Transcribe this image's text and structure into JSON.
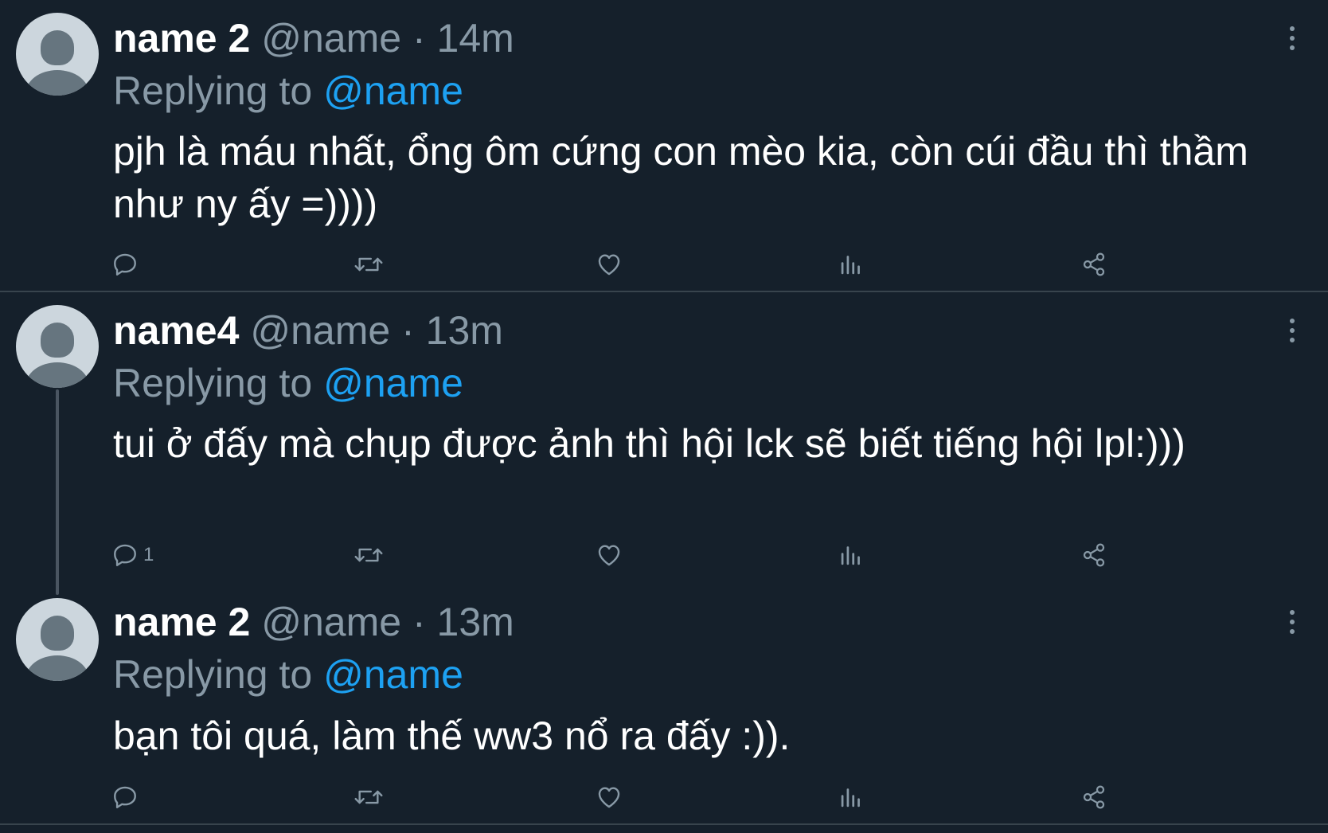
{
  "tweets": [
    {
      "name": "name 2",
      "handle": "@name",
      "separator": "·",
      "time": "14m",
      "reply_prefix": "Replying to",
      "reply_to": "@name",
      "text": "pjh là máu nhất, ổng ôm cứng con mèo kia, còn cúi đầu thì thầm như ny ấy =))))",
      "reply_count": ""
    },
    {
      "name": "name4",
      "handle": "@name",
      "separator": "·",
      "time": "13m",
      "reply_prefix": "Replying to",
      "reply_to": "@name",
      "text": "tui ở đấy mà chụp được ảnh thì hội lck sẽ biết tiếng hội lpl:)))",
      "reply_count": "1"
    },
    {
      "name": "name 2",
      "handle": "@name",
      "separator": "·",
      "time": "13m",
      "reply_prefix": "Replying to",
      "reply_to": "@name",
      "text": "bạn tôi quá, làm thế ww3 nổ ra đấy :)).",
      "reply_count": ""
    }
  ],
  "icons": {
    "reply": "reply-icon",
    "retweet": "retweet-icon",
    "like": "heart-icon",
    "analytics": "analytics-icon",
    "share": "share-icon",
    "more": "more-vertical-icon",
    "avatar": "default-avatar-icon"
  },
  "colors": {
    "background": "#15202b",
    "divider": "#38444d",
    "secondary_text": "#8899a6",
    "link": "#1da1f2",
    "avatar_bg": "#ccd6dd",
    "avatar_fg": "#66757f"
  }
}
